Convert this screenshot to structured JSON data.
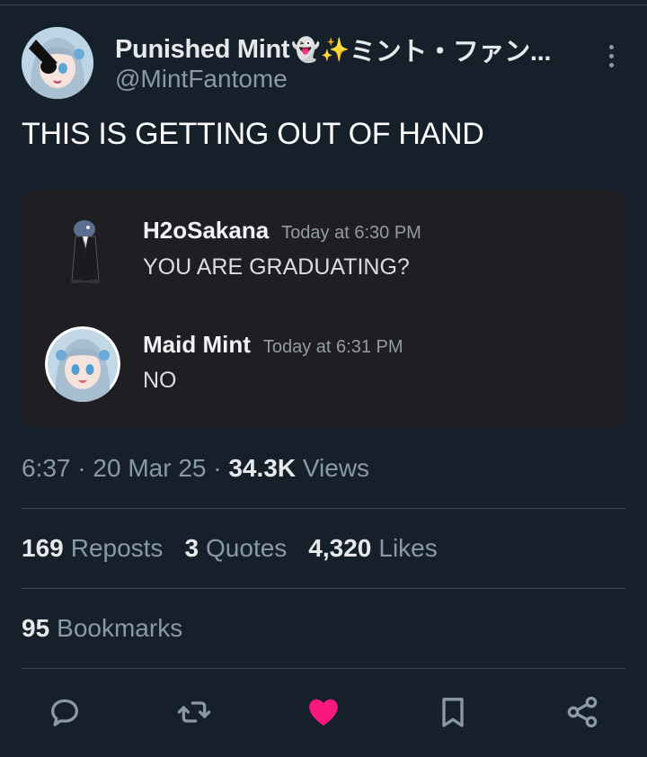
{
  "tweet": {
    "display_name": "Punished Mint",
    "name_emoji": "👻✨",
    "name_suffix": "ミント・ファン...",
    "handle": "@MintFantome",
    "text": "THIS IS GETTING OUT OF HAND"
  },
  "embed": {
    "messages": [
      {
        "author": "H2oSakana",
        "time": "Today at 6:30 PM",
        "text": "YOU ARE GRADUATING?"
      },
      {
        "author": "Maid Mint",
        "time": "Today at 6:31 PM",
        "text": "NO"
      }
    ]
  },
  "meta": {
    "time": "6:37",
    "sep1": " · ",
    "date": "20 Mar 25",
    "sep2": " · ",
    "views_count": "34.3K",
    "views_label": " Views"
  },
  "stats": {
    "reposts_count": "169",
    "reposts_label": "Reposts",
    "quotes_count": "3",
    "quotes_label": "Quotes",
    "likes_count": "4,320",
    "likes_label": "Likes",
    "bookmarks_count": "95",
    "bookmarks_label": "Bookmarks"
  },
  "colors": {
    "background": "#15202b",
    "like_active": "#f91880",
    "secondary_text": "#8b98a5",
    "embed_background": "#1f1f23"
  },
  "icons": [
    "more-icon",
    "reply-icon",
    "repost-icon",
    "like-icon",
    "bookmark-icon",
    "share-icon"
  ]
}
